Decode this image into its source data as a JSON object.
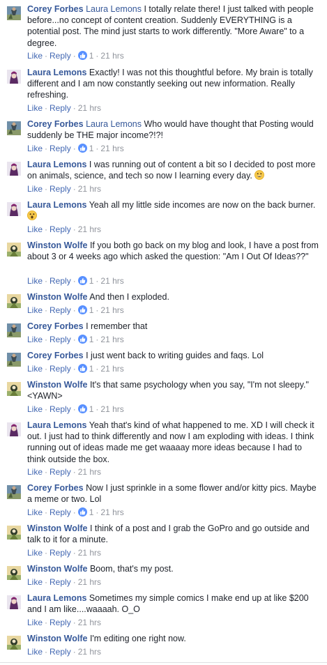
{
  "comments": [
    {
      "author": "Corey Forbes",
      "mention": "Laura Lemons",
      "text": "I totally relate there! I just talked with people before...no concept of content creation. Suddenly EVERYTHING is a potential post. The mind just starts to work differently. \"More Aware\" to a degree.",
      "likes": "1",
      "time": "21 hrs",
      "avatar": "corey-avatar"
    },
    {
      "author": "Laura Lemons",
      "mention": "",
      "text": "Exactly! I was not this thoughtful before. My brain is totally different and I am now constantly seeking out new information. Really refreshing.",
      "likes": "",
      "time": "21 hrs",
      "avatar": "laura-avatar"
    },
    {
      "author": "Corey Forbes",
      "mention": "Laura Lemons",
      "text": "Who would have thought that Posting would suddenly be THE major income?!?!",
      "likes": "1",
      "time": "21 hrs",
      "avatar": "corey-avatar"
    },
    {
      "author": "Laura Lemons",
      "mention": "",
      "text": "I was running out of content a bit so I decided to post more on animals, science, and tech so now I learning every day.",
      "emoji": "grinning-emoji",
      "likes": "",
      "time": "21 hrs",
      "avatar": "laura-avatar"
    },
    {
      "author": "Laura Lemons",
      "mention": "",
      "text": "Yeah all my little side incomes are now on the back burner.",
      "emoji": "surprised-emoji",
      "likes": "",
      "time": "21 hrs",
      "avatar": "laura-avatar"
    },
    {
      "author": "Winston Wolfe",
      "mention": "",
      "text": "If you both go back on my blog and look, I have a post from about 3 or 4 weeks ago which asked the question: \"Am I Out Of Ideas??\"",
      "likes": "1",
      "time": "21 hrs",
      "avatar": "winston-avatar"
    },
    {
      "author": "Winston Wolfe",
      "mention": "",
      "text": "And then I exploded.",
      "likes": "1",
      "time": "21 hrs",
      "avatar": "winston-avatar"
    },
    {
      "author": "Corey Forbes",
      "mention": "",
      "text": "I remember that",
      "likes": "1",
      "time": "21 hrs",
      "avatar": "corey-avatar"
    },
    {
      "author": "Corey Forbes",
      "mention": "",
      "text": "I just went back to writing guides and faqs. Lol",
      "likes": "1",
      "time": "21 hrs",
      "avatar": "corey-avatar"
    },
    {
      "author": "Winston Wolfe",
      "mention": "",
      "text": "It's that same psychology when you say, \"I'm not sleepy.\" <YAWN>",
      "likes": "1",
      "time": "21 hrs",
      "avatar": "winston-avatar"
    },
    {
      "author": "Laura Lemons",
      "mention": "",
      "text": "Yeah that's kind of what happened to me. XD I will check it out. I just had to think differently and now I am exploding with ideas. I think running out of ideas made me get waaaay more ideas because I had to think outside the box.",
      "likes": "",
      "time": "21 hrs",
      "avatar": "laura-avatar"
    },
    {
      "author": "Corey Forbes",
      "mention": "",
      "text": "Now I just sprinkle in a some flower and/or kitty pics. Maybe a meme or two. Lol",
      "likes": "1",
      "time": "21 hrs",
      "avatar": "corey-avatar"
    },
    {
      "author": "Winston Wolfe",
      "mention": "",
      "text": "I think of a post and I grab the GoPro and go outside and talk to it for a minute.",
      "likes": "",
      "time": "21 hrs",
      "avatar": "winston-avatar"
    },
    {
      "author": "Winston Wolfe",
      "mention": "",
      "text": "Boom, that's my post.",
      "likes": "",
      "time": "21 hrs",
      "avatar": "winston-avatar"
    },
    {
      "author": "Laura Lemons",
      "mention": "",
      "text": "Sometimes my simple comics I make end up at like $200 and I am like....waaaah. O_O",
      "likes": "",
      "time": "21 hrs",
      "avatar": "laura-avatar"
    },
    {
      "author": "Winston Wolfe",
      "mention": "",
      "text": "I'm editing one right now.",
      "likes": "",
      "time": "21 hrs",
      "avatar": "winston-avatar"
    }
  ],
  "actions": {
    "like_label": "Like",
    "reply_label": "Reply",
    "separator": "·"
  },
  "colors": {
    "author": "#365899",
    "link": "#4267b2",
    "meta": "#90949c",
    "text": "#1d2129",
    "like_icon": "#5890ff"
  }
}
